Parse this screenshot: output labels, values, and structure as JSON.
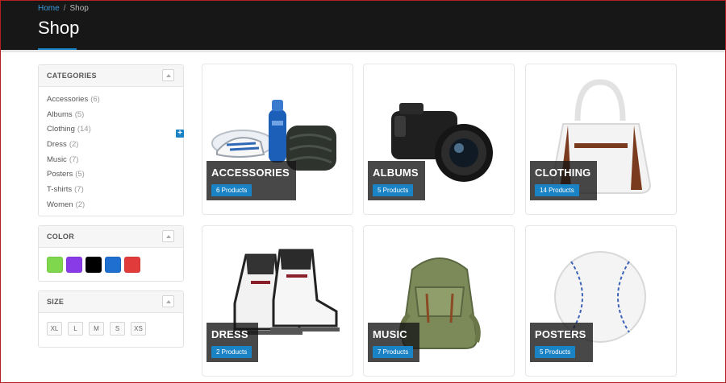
{
  "breadcrumb": {
    "home": "Home",
    "separator": "/",
    "current": "Shop"
  },
  "page": {
    "title": "Shop"
  },
  "colors": {
    "accent": "#1a83c5",
    "header_bg": "#171717",
    "label_bg": "#141414"
  },
  "sidebar": {
    "categories": {
      "title": "CATEGORIES",
      "items": [
        {
          "label": "Accessories",
          "count": "(6)"
        },
        {
          "label": "Albums",
          "count": "(5)"
        },
        {
          "label": "Clothing",
          "count": "(14)",
          "expandable": true
        },
        {
          "label": "Dress",
          "count": "(2)"
        },
        {
          "label": "Music",
          "count": "(7)"
        },
        {
          "label": "Posters",
          "count": "(5)"
        },
        {
          "label": "T-shirts",
          "count": "(7)"
        },
        {
          "label": "Women",
          "count": "(2)"
        }
      ]
    },
    "color": {
      "title": "COLOR",
      "swatches": [
        "#7fd74d",
        "#8a3be8",
        "#000000",
        "#1e6fd0",
        "#e23b3b"
      ]
    },
    "size": {
      "title": "SIZE",
      "options": [
        "XL",
        "L",
        "M",
        "S",
        "XS"
      ]
    }
  },
  "products": [
    {
      "name": "ACCESSORIES",
      "count": "6 Products",
      "icon": "sneakers-bottle-towel"
    },
    {
      "name": "ALBUMS",
      "count": "5 Products",
      "icon": "camera"
    },
    {
      "name": "CLOTHING",
      "count": "14 Products",
      "icon": "handbag"
    },
    {
      "name": "DRESS",
      "count": "2 Products",
      "icon": "ice-skates"
    },
    {
      "name": "MUSIC",
      "count": "7 Products",
      "icon": "backpack"
    },
    {
      "name": "POSTERS",
      "count": "5 Products",
      "icon": "baseball"
    }
  ]
}
